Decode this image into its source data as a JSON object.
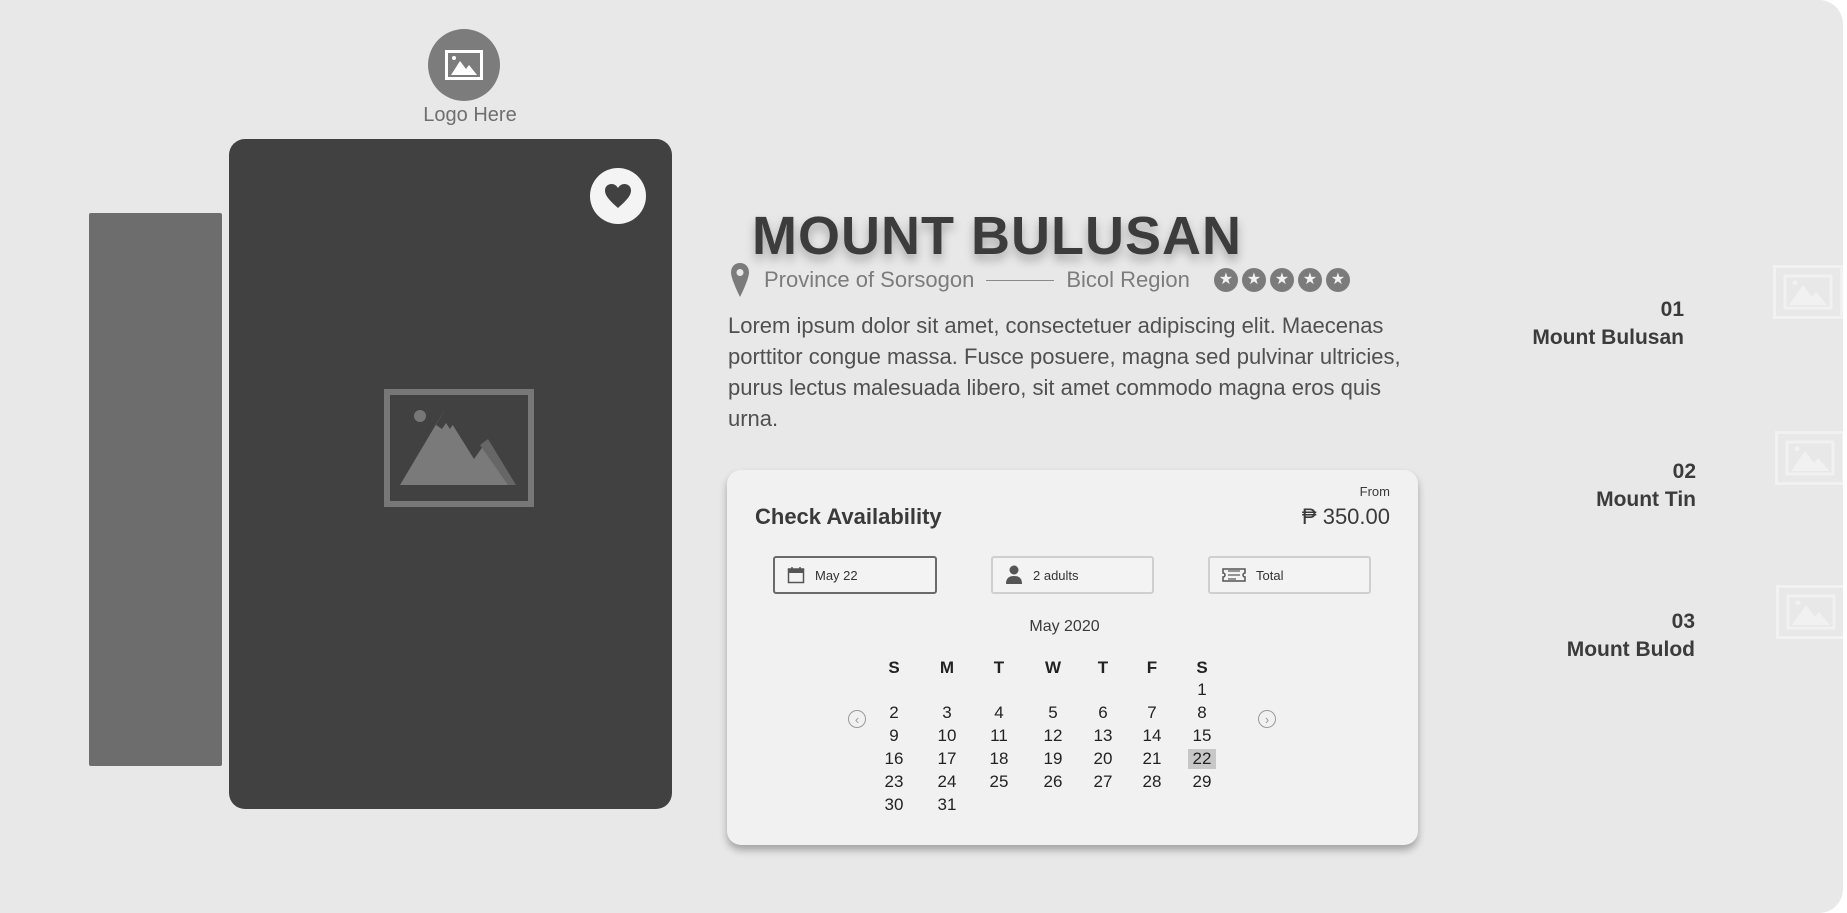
{
  "logo": {
    "text": "Logo Here",
    "icon": "image-icon"
  },
  "hero": {
    "favorite_icon": "heart-icon",
    "image_icon": "image-placeholder-icon"
  },
  "destination": {
    "title": "MOUNT BULUSAN",
    "province": "Province of Sorsogon",
    "region": "Bicol Region",
    "rating": 5,
    "rating_max": 5,
    "description": "Lorem ipsum dolor sit amet, consectetuer adipiscing elit. Maecenas porttitor congue massa. Fusce posuere, magna sed pulvinar ultricies, purus lectus malesuada libero, sit amet commodo magna eros quis urna."
  },
  "availability": {
    "title": "Check Availability",
    "from_label": "From",
    "price": "₱ 350.00",
    "date_field": "May 22",
    "guests_field": "2 adults",
    "total_field": "Total",
    "calendar": {
      "month": "May 2020",
      "weekdays": [
        "S",
        "M",
        "T",
        "W",
        "T",
        "F",
        "S"
      ],
      "selected_day": "22",
      "weeks": [
        [
          "",
          "",
          "",
          "",
          "",
          "",
          "1"
        ],
        [
          "2",
          "3",
          "4",
          "5",
          "6",
          "7",
          "8"
        ],
        [
          "9",
          "10",
          "11",
          "12",
          "13",
          "14",
          "15"
        ],
        [
          "16",
          "17",
          "18",
          "19",
          "20",
          "21",
          "22"
        ],
        [
          "23",
          "24",
          "25",
          "26",
          "27",
          "28",
          "29"
        ],
        [
          "30",
          "31",
          "",
          "",
          "",
          "",
          ""
        ]
      ]
    }
  },
  "destinations": [
    {
      "number": "01",
      "name": "Mount Bulusan"
    },
    {
      "number": "02",
      "name": "Mount Tin"
    },
    {
      "number": "03",
      "name": "Mount Bulod"
    }
  ],
  "colors": {
    "background": "#e8e8e8",
    "card_dark": "#414141",
    "card_back": "#6d6d6d",
    "accent_gray": "#7c7c7c"
  }
}
